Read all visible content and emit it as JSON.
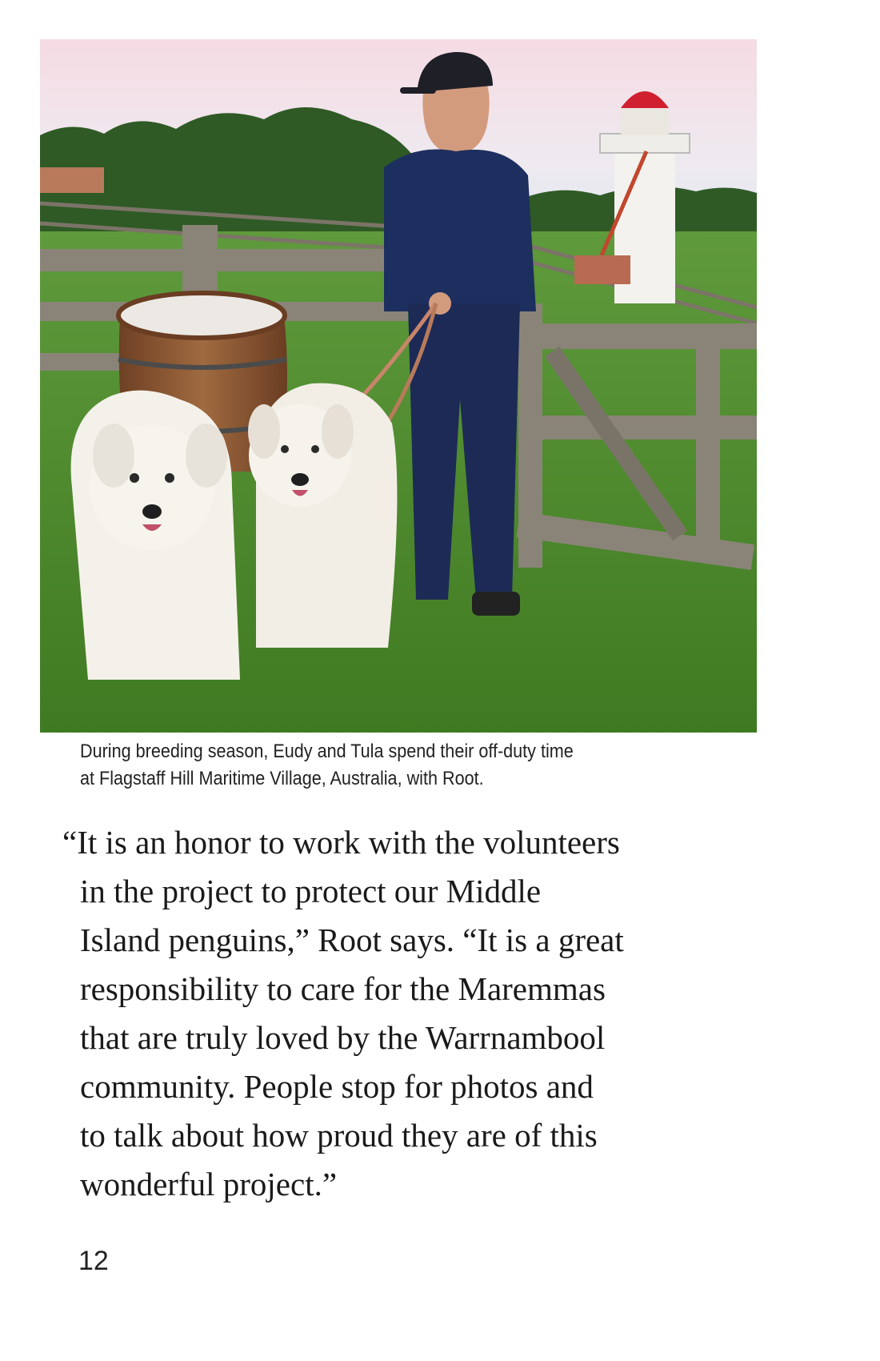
{
  "photo": {
    "subject": "Man in navy work clothes and cap holding two white Maremma dogs on leashes beside a wooden barrel and fence, with a white lighthouse with red dome in the background"
  },
  "caption": {
    "line1": "During breeding season, Eudy and Tula spend their off-duty time",
    "line2": "at Flagstaff Hill Maritime Village, Australia, with Root."
  },
  "quote": {
    "lines": [
      "“It is an honor to work with the volunteers",
      "in the project to protect our Middle",
      "Island penguins,” Root says. “It is a great",
      "responsibility to care for the Maremmas",
      "that are truly loved by the Warrnambool",
      "community. People stop for photos and",
      "to talk about how proud they are of this",
      "wonderful project.”"
    ]
  },
  "page_number": "12"
}
